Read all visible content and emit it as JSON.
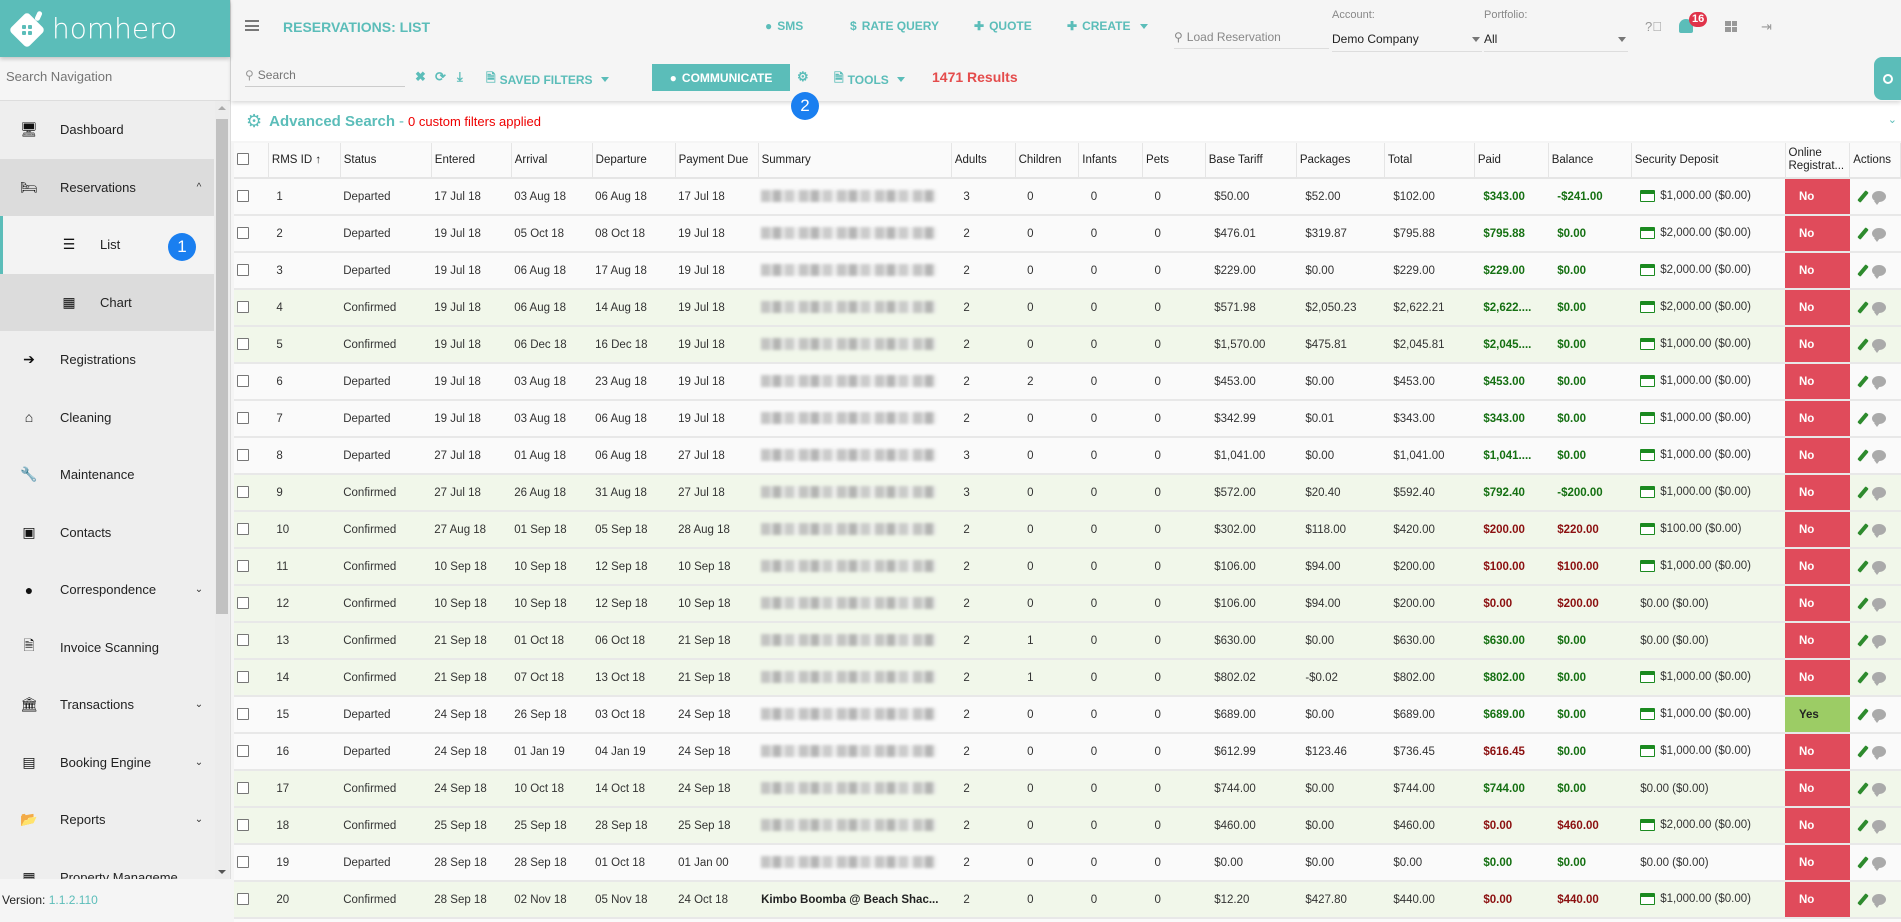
{
  "brand": {
    "name": "homhero"
  },
  "sidebar": {
    "search_placeholder": "Search Navigation",
    "items": [
      {
        "label": "Dashboard",
        "icon": "monitor-icon"
      },
      {
        "label": "Reservations",
        "icon": "bed-icon",
        "chevron": "up"
      },
      {
        "label": "List",
        "icon": "list-icon",
        "badge": "1"
      },
      {
        "label": "Chart",
        "icon": "calendar-icon"
      },
      {
        "label": "Registrations",
        "icon": "sign-in-icon"
      },
      {
        "label": "Cleaning",
        "icon": "home-icon"
      },
      {
        "label": "Maintenance",
        "icon": "wrench-icon"
      },
      {
        "label": "Contacts",
        "icon": "contact-card-icon"
      },
      {
        "label": "Correspondence",
        "icon": "comment-icon",
        "chevron": "down"
      },
      {
        "label": "Invoice Scanning",
        "icon": "pdf-file-icon"
      },
      {
        "label": "Transactions",
        "icon": "bank-icon",
        "chevron": "down"
      },
      {
        "label": "Booking Engine",
        "icon": "booking-icon",
        "chevron": "down"
      },
      {
        "label": "Reports",
        "icon": "folder-open-icon",
        "chevron": "down"
      },
      {
        "label": "Property Manageme",
        "icon": "table-icon"
      }
    ],
    "version_label": "Version",
    "version": "1.1.2.110"
  },
  "header": {
    "title": "RESERVATIONS: LIST",
    "buttons": {
      "sms": "SMS",
      "rate_query": "RATE QUERY",
      "quote": "QUOTE",
      "create": "CREATE"
    },
    "load_reservation_placeholder": "Load Reservation",
    "account_label": "Account:",
    "account_value": "Demo Company",
    "portfolio_label": "Portfolio:",
    "portfolio_value": "All",
    "notification_count": "16"
  },
  "toolbar": {
    "search_placeholder": "Search",
    "saved_filters": "SAVED FILTERS",
    "communicate": "COMMUNICATE",
    "tools": "TOOLS",
    "results": "1471 Results",
    "badge": "2"
  },
  "advanced_search": {
    "title": "Advanced Search",
    "separator": "-",
    "filters": "0 custom filters applied"
  },
  "table": {
    "columns": [
      "RMS ID",
      "Status",
      "Entered",
      "Arrival",
      "Departure",
      "Payment Due",
      "Summary",
      "Adults",
      "Children",
      "Infants",
      "Pets",
      "Base Tariff",
      "Packages",
      "Total",
      "Paid",
      "Balance",
      "Security Deposit",
      "Online Registrat...",
      "Actions"
    ],
    "sort_indicator": "↑",
    "rows": [
      {
        "id": "1",
        "status": "Departed",
        "entered": "17 Jul 18",
        "arrival": "03 Aug 18",
        "departure": "06 Aug 18",
        "due": "17 Jul 18",
        "summary": "",
        "adults": "3",
        "children": "0",
        "infants": "0",
        "pets": "0",
        "base": "$50.00",
        "packages": "$52.00",
        "total": "$102.00",
        "paid": "$343.00",
        "paid_state": "ok",
        "balance": "-$241.00",
        "balance_state": "ok",
        "deposit": "$1,000.00 ($0.00)",
        "deposit_card": true,
        "online": "No"
      },
      {
        "id": "2",
        "status": "Departed",
        "entered": "19 Jul 18",
        "arrival": "05 Oct 18",
        "departure": "08 Oct 18",
        "due": "19 Jul 18",
        "summary": "",
        "adults": "2",
        "children": "0",
        "infants": "0",
        "pets": "0",
        "base": "$476.01",
        "packages": "$319.87",
        "total": "$795.88",
        "paid": "$795.88",
        "paid_state": "ok",
        "balance": "$0.00",
        "balance_state": "ok",
        "deposit": "$2,000.00 ($0.00)",
        "deposit_card": true,
        "online": "No"
      },
      {
        "id": "3",
        "status": "Departed",
        "entered": "19 Jul 18",
        "arrival": "06 Aug 18",
        "departure": "17 Aug 18",
        "due": "19 Jul 18",
        "summary": "",
        "adults": "2",
        "children": "0",
        "infants": "0",
        "pets": "0",
        "base": "$229.00",
        "packages": "$0.00",
        "total": "$229.00",
        "paid": "$229.00",
        "paid_state": "ok",
        "balance": "$0.00",
        "balance_state": "ok",
        "deposit": "$2,000.00 ($0.00)",
        "deposit_card": true,
        "online": "No"
      },
      {
        "id": "4",
        "status": "Confirmed",
        "entered": "19 Jul 18",
        "arrival": "06 Aug 18",
        "departure": "14 Aug 18",
        "due": "19 Jul 18",
        "summary": "",
        "adults": "2",
        "children": "0",
        "infants": "0",
        "pets": "0",
        "base": "$571.98",
        "packages": "$2,050.23",
        "total": "$2,622.21",
        "paid": "$2,622....",
        "paid_state": "ok",
        "balance": "$0.00",
        "balance_state": "ok",
        "deposit": "$2,000.00 ($0.00)",
        "deposit_card": true,
        "online": "No"
      },
      {
        "id": "5",
        "status": "Confirmed",
        "entered": "19 Jul 18",
        "arrival": "06 Dec 18",
        "departure": "16 Dec 18",
        "due": "19 Jul 18",
        "summary": "",
        "adults": "2",
        "children": "0",
        "infants": "0",
        "pets": "0",
        "base": "$1,570.00",
        "packages": "$475.81",
        "total": "$2,045.81",
        "paid": "$2,045....",
        "paid_state": "ok",
        "balance": "$0.00",
        "balance_state": "ok",
        "deposit": "$1,000.00 ($0.00)",
        "deposit_card": true,
        "online": "No"
      },
      {
        "id": "6",
        "status": "Departed",
        "entered": "19 Jul 18",
        "arrival": "03 Aug 18",
        "departure": "23 Aug 18",
        "due": "19 Jul 18",
        "summary": "",
        "adults": "2",
        "children": "2",
        "infants": "0",
        "pets": "0",
        "base": "$453.00",
        "packages": "$0.00",
        "total": "$453.00",
        "paid": "$453.00",
        "paid_state": "ok",
        "balance": "$0.00",
        "balance_state": "ok",
        "deposit": "$1,000.00 ($0.00)",
        "deposit_card": true,
        "online": "No"
      },
      {
        "id": "7",
        "status": "Departed",
        "entered": "19 Jul 18",
        "arrival": "03 Aug 18",
        "departure": "06 Aug 18",
        "due": "19 Jul 18",
        "summary": "",
        "adults": "2",
        "children": "0",
        "infants": "0",
        "pets": "0",
        "base": "$342.99",
        "packages": "$0.01",
        "total": "$343.00",
        "paid": "$343.00",
        "paid_state": "ok",
        "balance": "$0.00",
        "balance_state": "ok",
        "deposit": "$1,000.00 ($0.00)",
        "deposit_card": true,
        "online": "No"
      },
      {
        "id": "8",
        "status": "Departed",
        "entered": "27 Jul 18",
        "arrival": "01 Aug 18",
        "departure": "06 Aug 18",
        "due": "27 Jul 18",
        "summary": "",
        "adults": "3",
        "children": "0",
        "infants": "0",
        "pets": "0",
        "base": "$1,041.00",
        "packages": "$0.00",
        "total": "$1,041.00",
        "paid": "$1,041....",
        "paid_state": "ok",
        "balance": "$0.00",
        "balance_state": "ok",
        "deposit": "$1,000.00 ($0.00)",
        "deposit_card": true,
        "online": "No"
      },
      {
        "id": "9",
        "status": "Confirmed",
        "entered": "27 Jul 18",
        "arrival": "26 Aug 18",
        "departure": "31 Aug 18",
        "due": "27 Jul 18",
        "summary": "",
        "adults": "3",
        "children": "0",
        "infants": "0",
        "pets": "0",
        "base": "$572.00",
        "packages": "$20.40",
        "total": "$592.40",
        "paid": "$792.40",
        "paid_state": "ok",
        "balance": "-$200.00",
        "balance_state": "ok",
        "deposit": "$1,000.00 ($0.00)",
        "deposit_card": true,
        "online": "No"
      },
      {
        "id": "10",
        "status": "Confirmed",
        "entered": "27 Aug 18",
        "arrival": "01 Sep 18",
        "departure": "05 Sep 18",
        "due": "28 Aug 18",
        "summary": "",
        "adults": "2",
        "children": "0",
        "infants": "0",
        "pets": "0",
        "base": "$302.00",
        "packages": "$118.00",
        "total": "$420.00",
        "paid": "$200.00",
        "paid_state": "due",
        "balance": "$220.00",
        "balance_state": "due",
        "deposit": "$100.00 ($0.00)",
        "deposit_card": true,
        "online": "No"
      },
      {
        "id": "11",
        "status": "Confirmed",
        "entered": "10 Sep 18",
        "arrival": "10 Sep 18",
        "departure": "12 Sep 18",
        "due": "10 Sep 18",
        "summary": "",
        "adults": "2",
        "children": "0",
        "infants": "0",
        "pets": "0",
        "base": "$106.00",
        "packages": "$94.00",
        "total": "$200.00",
        "paid": "$100.00",
        "paid_state": "due",
        "balance": "$100.00",
        "balance_state": "due",
        "deposit": "$1,000.00 ($0.00)",
        "deposit_card": true,
        "online": "No"
      },
      {
        "id": "12",
        "status": "Confirmed",
        "entered": "10 Sep 18",
        "arrival": "10 Sep 18",
        "departure": "12 Sep 18",
        "due": "10 Sep 18",
        "summary": "",
        "adults": "2",
        "children": "0",
        "infants": "0",
        "pets": "0",
        "base": "$106.00",
        "packages": "$94.00",
        "total": "$200.00",
        "paid": "$0.00",
        "paid_state": "due",
        "balance": "$200.00",
        "balance_state": "due",
        "deposit": "$0.00 ($0.00)",
        "deposit_card": false,
        "online": "No"
      },
      {
        "id": "13",
        "status": "Confirmed",
        "entered": "21 Sep 18",
        "arrival": "01 Oct 18",
        "departure": "06 Oct 18",
        "due": "21 Sep 18",
        "summary": "",
        "adults": "2",
        "children": "1",
        "infants": "0",
        "pets": "0",
        "base": "$630.00",
        "packages": "$0.00",
        "total": "$630.00",
        "paid": "$630.00",
        "paid_state": "ok",
        "balance": "$0.00",
        "balance_state": "ok",
        "deposit": "$0.00 ($0.00)",
        "deposit_card": false,
        "online": "No"
      },
      {
        "id": "14",
        "status": "Confirmed",
        "entered": "21 Sep 18",
        "arrival": "07 Oct 18",
        "departure": "13 Oct 18",
        "due": "21 Sep 18",
        "summary": "",
        "adults": "2",
        "children": "1",
        "infants": "0",
        "pets": "0",
        "base": "$802.02",
        "packages": "-$0.02",
        "total": "$802.00",
        "paid": "$802.00",
        "paid_state": "ok",
        "balance": "$0.00",
        "balance_state": "ok",
        "deposit": "$1,000.00 ($0.00)",
        "deposit_card": true,
        "online": "No"
      },
      {
        "id": "15",
        "status": "Departed",
        "entered": "24 Sep 18",
        "arrival": "26 Sep 18",
        "departure": "03 Oct 18",
        "due": "24 Sep 18",
        "summary": "",
        "adults": "2",
        "children": "0",
        "infants": "0",
        "pets": "0",
        "base": "$689.00",
        "packages": "$0.00",
        "total": "$689.00",
        "paid": "$689.00",
        "paid_state": "ok",
        "balance": "$0.00",
        "balance_state": "ok",
        "deposit": "$1,000.00 ($0.00)",
        "deposit_card": true,
        "online": "Yes"
      },
      {
        "id": "16",
        "status": "Departed",
        "entered": "24 Sep 18",
        "arrival": "01 Jan 19",
        "departure": "04 Jan 19",
        "due": "24 Sep 18",
        "summary": "",
        "adults": "2",
        "children": "0",
        "infants": "0",
        "pets": "0",
        "base": "$612.99",
        "packages": "$123.46",
        "total": "$736.45",
        "paid": "$616.45",
        "paid_state": "due",
        "balance": "$0.00",
        "balance_state": "ok",
        "deposit": "$1,000.00 ($0.00)",
        "deposit_card": true,
        "online": "No"
      },
      {
        "id": "17",
        "status": "Confirmed",
        "entered": "24 Sep 18",
        "arrival": "10 Oct 18",
        "departure": "14 Oct 18",
        "due": "24 Sep 18",
        "summary": "",
        "adults": "2",
        "children": "0",
        "infants": "0",
        "pets": "0",
        "base": "$744.00",
        "packages": "$0.00",
        "total": "$744.00",
        "paid": "$744.00",
        "paid_state": "ok",
        "balance": "$0.00",
        "balance_state": "ok",
        "deposit": "$0.00 ($0.00)",
        "deposit_card": false,
        "online": "No"
      },
      {
        "id": "18",
        "status": "Confirmed",
        "entered": "25 Sep 18",
        "arrival": "25 Sep 18",
        "departure": "28 Sep 18",
        "due": "25 Sep 18",
        "summary": "",
        "adults": "2",
        "children": "0",
        "infants": "0",
        "pets": "0",
        "base": "$460.00",
        "packages": "$0.00",
        "total": "$460.00",
        "paid": "$0.00",
        "paid_state": "due",
        "balance": "$460.00",
        "balance_state": "due",
        "deposit": "$2,000.00 ($0.00)",
        "deposit_card": true,
        "online": "No"
      },
      {
        "id": "19",
        "status": "Departed",
        "entered": "28 Sep 18",
        "arrival": "28 Sep 18",
        "departure": "01 Oct 18",
        "due": "01 Jan 00",
        "summary": "",
        "adults": "2",
        "children": "0",
        "infants": "0",
        "pets": "0",
        "base": "$0.00",
        "packages": "$0.00",
        "total": "$0.00",
        "paid": "$0.00",
        "paid_state": "ok",
        "balance": "$0.00",
        "balance_state": "ok",
        "deposit": "$0.00 ($0.00)",
        "deposit_card": false,
        "online": "No"
      },
      {
        "id": "20",
        "status": "Confirmed",
        "entered": "28 Sep 18",
        "arrival": "02 Nov 18",
        "departure": "05 Nov 18",
        "due": "24 Oct 18",
        "summary": "Kimbo Boomba @ Beach Shac...",
        "adults": "2",
        "children": "0",
        "infants": "0",
        "pets": "0",
        "base": "$12.20",
        "packages": "$427.80",
        "total": "$440.00",
        "paid": "$0.00",
        "paid_state": "due",
        "balance": "$440.00",
        "balance_state": "due",
        "deposit": "$1,000.00 ($0.00)",
        "deposit_card": true,
        "online": "No"
      }
    ]
  },
  "colors": {
    "brand": "#5bbdb9",
    "results": "#e44c4c",
    "badge": "#1a7ff0",
    "no": "#e04b5b",
    "yes": "#9ccc65",
    "paid_ok": "#157012",
    "paid_due": "#8b1010"
  }
}
